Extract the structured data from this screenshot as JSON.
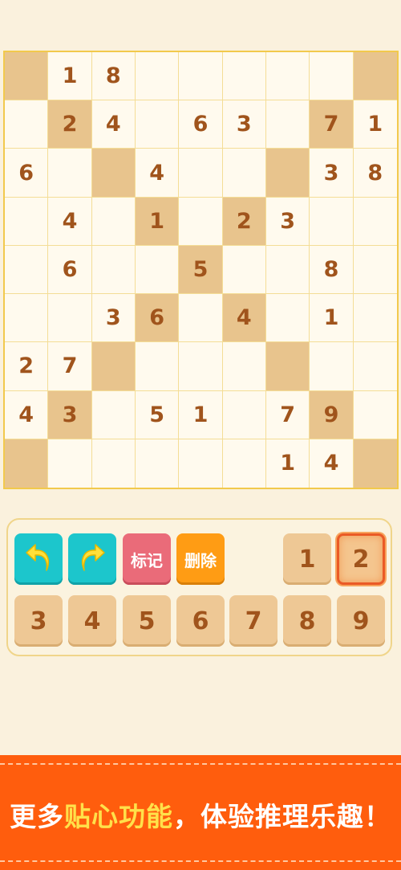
{
  "board": {
    "rows": [
      [
        "",
        "1",
        "8",
        "",
        "",
        "",
        "",
        "",
        ""
      ],
      [
        "",
        "2",
        "4",
        "",
        "6",
        "3",
        "",
        "7",
        "1"
      ],
      [
        "6",
        "",
        "",
        "4",
        "",
        "",
        "",
        "3",
        "8"
      ],
      [
        "",
        "4",
        "",
        "1",
        "",
        "2",
        "3",
        "",
        ""
      ],
      [
        "",
        "6",
        "",
        "",
        "5",
        "",
        "",
        "8",
        ""
      ],
      [
        "",
        "",
        "3",
        "6",
        "",
        "4",
        "",
        "1",
        ""
      ],
      [
        "2",
        "7",
        "",
        "",
        "",
        "",
        "",
        "",
        ""
      ],
      [
        "4",
        "3",
        "",
        "5",
        "1",
        "",
        "7",
        "9",
        ""
      ],
      [
        "",
        "",
        "",
        "",
        "",
        "",
        "1",
        "4",
        ""
      ]
    ],
    "shaded": [
      [
        0,
        0
      ],
      [
        0,
        8
      ],
      [
        1,
        1
      ],
      [
        1,
        7
      ],
      [
        2,
        2
      ],
      [
        2,
        6
      ],
      [
        3,
        3
      ],
      [
        3,
        5
      ],
      [
        4,
        4
      ],
      [
        5,
        3
      ],
      [
        5,
        5
      ],
      [
        6,
        2
      ],
      [
        6,
        6
      ],
      [
        7,
        1
      ],
      [
        7,
        7
      ],
      [
        8,
        0
      ],
      [
        8,
        8
      ]
    ]
  },
  "controls": {
    "undo_icon": "undo-arrow-icon",
    "redo_icon": "redo-arrow-icon",
    "mark_label": "标记",
    "delete_label": "删除",
    "numbers": [
      "1",
      "2",
      "3",
      "4",
      "5",
      "6",
      "7",
      "8",
      "9"
    ],
    "selected_number": "2"
  },
  "banner": {
    "part1": "更多",
    "highlight": "贴心功能",
    "part2": "，体验推理乐趣！"
  },
  "colors": {
    "background": "#faf1dd",
    "shaded_cell": "#e8c48d",
    "digit": "#a0541c",
    "grid_border": "#f2c94c",
    "cyan_button": "#1cc6cc",
    "mark_button": "#ea6b79",
    "delete_button": "#ff9c14",
    "number_tile": "#eec895",
    "banner": "#ff5d0d",
    "banner_highlight": "#ffe14a"
  }
}
